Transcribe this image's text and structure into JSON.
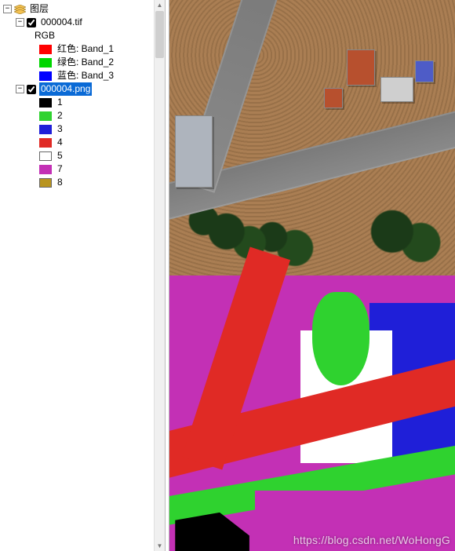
{
  "tree": {
    "root_label": "图层",
    "layer_tif": {
      "name": "000004.tif",
      "checked": true,
      "rgb_label": "RGB",
      "bands": [
        {
          "color": "#ff0000",
          "label": "红色:   Band_1"
        },
        {
          "color": "#00d600",
          "label": "绿色: Band_2"
        },
        {
          "color": "#0000ff",
          "label": "蓝色:   Band_3"
        }
      ]
    },
    "layer_png": {
      "name": "000004.png",
      "checked": true,
      "selected": true,
      "classes": [
        {
          "color": "#000000",
          "label": "1",
          "outlined": false
        },
        {
          "color": "#2fd22f",
          "label": "2",
          "outlined": false
        },
        {
          "color": "#1f1fd8",
          "label": "3",
          "outlined": false
        },
        {
          "color": "#e02a25",
          "label": "4",
          "outlined": false
        },
        {
          "color": "#ffffff",
          "label": "5",
          "outlined": true
        },
        {
          "color": "#c330b5",
          "label": "7",
          "outlined": false
        },
        {
          "color": "#b8941f",
          "label": "8",
          "outlined": true
        }
      ]
    }
  },
  "watermark": "https://blog.csdn.net/WoHongG"
}
